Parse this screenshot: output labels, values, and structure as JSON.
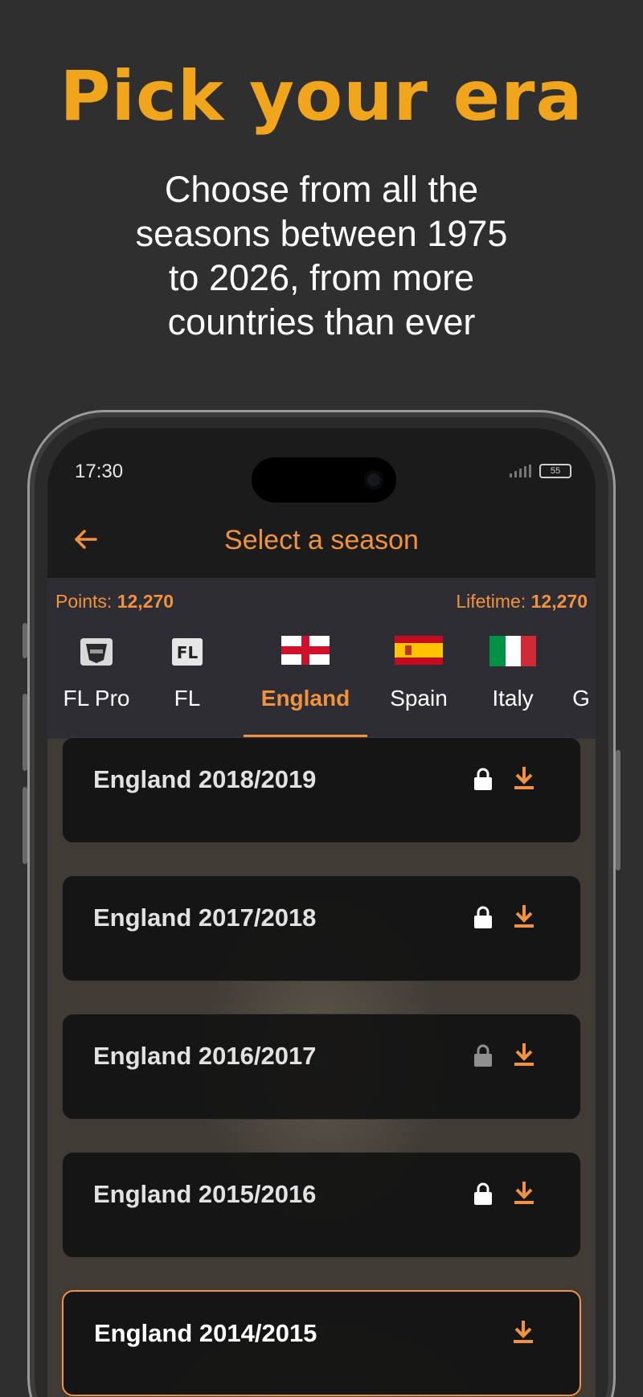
{
  "hero": {
    "title": "Pick your era",
    "subtitle_lines": [
      "Choose from all the",
      "seasons between 1975",
      "to 2026, from more",
      "countries than ever"
    ]
  },
  "status": {
    "time": "17:30",
    "battery": "55"
  },
  "appbar": {
    "title": "Select a season",
    "back_icon": "arrow-left-icon"
  },
  "points": {
    "label": "Points:",
    "value": "12,270",
    "lifetime_label": "Lifetime:",
    "lifetime_value": "12,270"
  },
  "tabs": [
    {
      "label": "FL Pro",
      "icon": "fl-pro-badge-icon",
      "active": false
    },
    {
      "label": "FL",
      "icon": "fl-logo-icon",
      "active": false
    },
    {
      "label": "England",
      "icon": "england-flag-icon",
      "active": true
    },
    {
      "label": "Spain",
      "icon": "spain-flag-icon",
      "active": false
    },
    {
      "label": "Italy",
      "icon": "italy-flag-icon",
      "active": false
    },
    {
      "label": "G",
      "icon": "",
      "active": false
    }
  ],
  "seasons": [
    {
      "label": "England 2018/2019",
      "locked": true,
      "lock_color": "#ffffff"
    },
    {
      "label": "England 2017/2018",
      "locked": true,
      "lock_color": "#ffffff"
    },
    {
      "label": "England 2016/2017",
      "locked": true,
      "lock_color": "#8f8f8f"
    },
    {
      "label": "England 2015/2016",
      "locked": true,
      "lock_color": "#ffffff"
    },
    {
      "label": "England 2014/2015",
      "locked": false,
      "selected": true
    }
  ],
  "colors": {
    "accent": "#f0923e",
    "title": "#f0a51c",
    "background": "#2f2f2f"
  }
}
